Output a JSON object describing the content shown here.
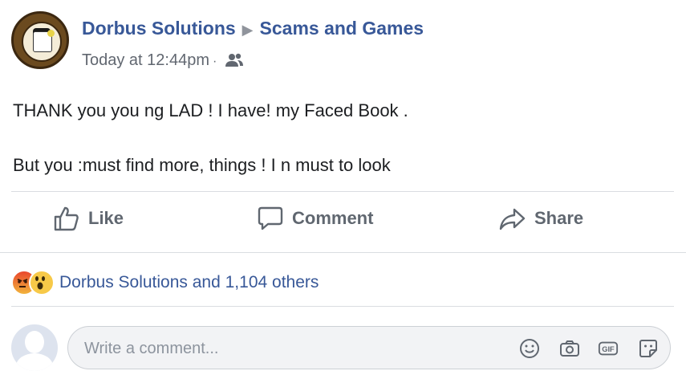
{
  "header": {
    "author": "Dorbus Solutions",
    "separator": "▶",
    "group": "Scams and Games",
    "timestamp": "Today at 12:44pm",
    "meta_dot": "·"
  },
  "post": {
    "paragraphs": [
      "THANK you you ng LAD ! I have! my Faced Book .",
      "But you :must find more, things ! I n must to look"
    ]
  },
  "actions": {
    "like_label": "Like",
    "comment_label": "Comment",
    "share_label": "Share"
  },
  "reactions": {
    "icons": [
      "angry-emoji",
      "wow-emoji"
    ],
    "summary": "Dorbus Solutions and 1,104 others"
  },
  "comment": {
    "placeholder": "Write a comment...",
    "icons": [
      "emoji-icon",
      "camera-icon",
      "gif-icon",
      "sticker-icon"
    ]
  },
  "colors": {
    "link": "#385898",
    "action": "#606770",
    "divider": "#dadde1"
  }
}
